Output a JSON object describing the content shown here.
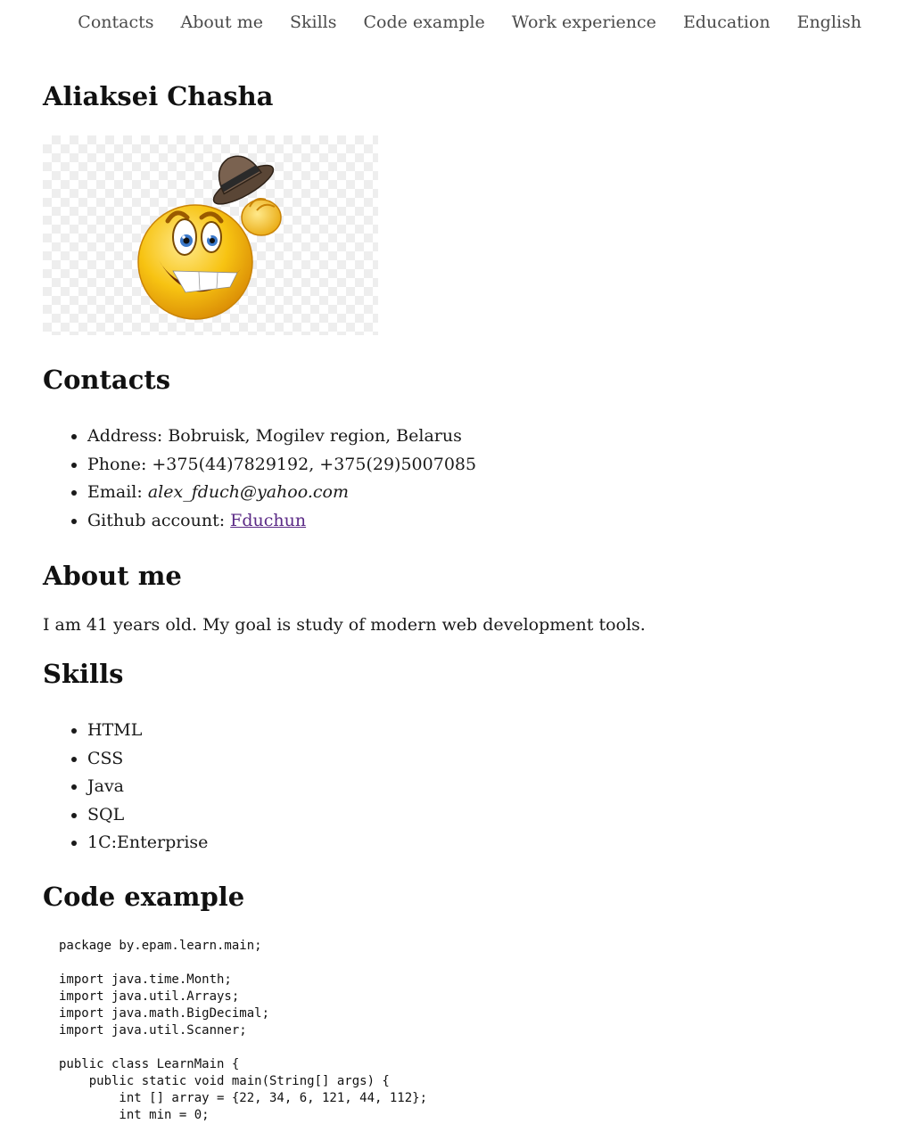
{
  "nav": {
    "items": [
      "Contacts",
      "About me",
      "Skills",
      "Code example",
      "Work experience",
      "Education",
      "English"
    ]
  },
  "header": {
    "name": "Aliaksei Chasha"
  },
  "contacts": {
    "title": "Contacts",
    "address_label": "Address:",
    "address_value": "Bobruisk, Mogilev region, Belarus",
    "phone_label": "Phone:",
    "phone_value": "+375(44)7829192, +375(29)5007085",
    "email_label": "Email:",
    "email_value": "alex_fduch@yahoo.com",
    "github_label": "Github account:",
    "github_value": "Fduchun"
  },
  "about": {
    "title": "About me",
    "text": "I am 41 years old. My goal is study of modern web development tools."
  },
  "skills": {
    "title": "Skills",
    "items": [
      "HTML",
      "CSS",
      "Java",
      "SQL",
      "1C:Enterprise"
    ]
  },
  "code": {
    "title": "Code example",
    "lines": [
      "package by.epam.learn.main;",
      "",
      "import java.time.Month;",
      "import java.util.Arrays;",
      "import java.math.BigDecimal;",
      "import java.util.Scanner;",
      "",
      "public class LearnMain {",
      "    public static void main(String[] args) {",
      "        int [] array = {22, 34, 6, 121, 44, 112};",
      "        int min = 0;"
    ]
  },
  "colors": {
    "link": "#5b2a86",
    "nav_text": "#4a4a4a",
    "heading": "#111111"
  },
  "icons": {
    "photo": "smiley-tipping-hat-icon"
  }
}
